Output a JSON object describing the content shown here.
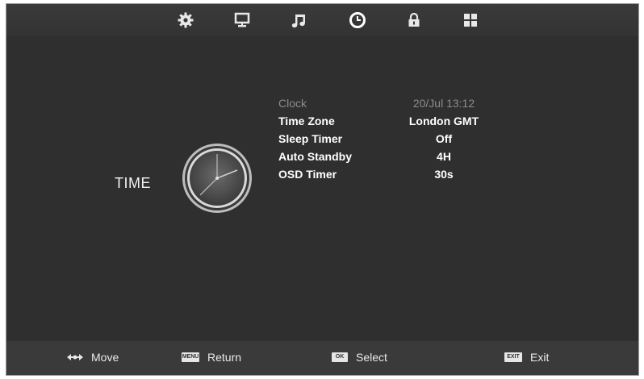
{
  "top_tabs": [
    {
      "icon": "gear-icon"
    },
    {
      "icon": "monitor-icon"
    },
    {
      "icon": "music-note-icon"
    },
    {
      "icon": "clock-icon"
    },
    {
      "icon": "lock-icon"
    },
    {
      "icon": "grid-icon"
    }
  ],
  "section": {
    "title": "TIME",
    "icon": "analog-clock-icon"
  },
  "menu": {
    "clock": {
      "label": "Clock",
      "value": "20/Jul 13:12"
    },
    "time_zone": {
      "label": "Time Zone",
      "value": "London GMT"
    },
    "sleep_timer": {
      "label": "Sleep Timer",
      "value": "Off"
    },
    "auto_standby": {
      "label": "Auto Standby",
      "value": "4H"
    },
    "osd_timer": {
      "label": "OSD Timer",
      "value": "30s"
    }
  },
  "footer": {
    "move": {
      "label": "Move"
    },
    "return": {
      "label": "Return",
      "key": "MENU"
    },
    "select": {
      "label": "Select",
      "key": "OK"
    },
    "exit": {
      "label": "Exit",
      "key": "EXIT"
    }
  },
  "colors": {
    "background": "#2f2f2f",
    "text": "#ffffff",
    "dim_text": "#8c8c8c"
  }
}
